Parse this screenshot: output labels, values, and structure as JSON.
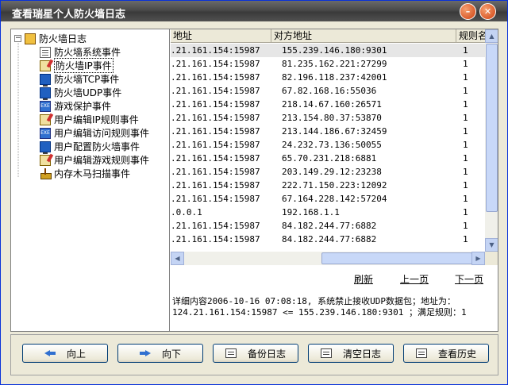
{
  "window": {
    "title": "查看瑞星个人防火墙日志"
  },
  "tree": {
    "root": "防火墙日志",
    "items": [
      "防火墙系统事件",
      "防火墙IP事件",
      "防火墙TCP事件",
      "防火墙UDP事件",
      "游戏保护事件",
      "用户编辑IP规则事件",
      "用户编辑访问规则事件",
      "用户配置防火墙事件",
      "用户编辑游戏规则事件",
      "内存木马扫描事件"
    ],
    "selected_index": 1
  },
  "table": {
    "columns": [
      "地址",
      "对方地址",
      "规则名"
    ],
    "rows": [
      [
        ".21.161.154:15987",
        "155.239.146.180:9301",
        "1"
      ],
      [
        ".21.161.154:15987",
        "81.235.162.221:27299",
        "1"
      ],
      [
        ".21.161.154:15987",
        "82.196.118.237:42001",
        "1"
      ],
      [
        ".21.161.154:15987",
        "67.82.168.16:55036",
        "1"
      ],
      [
        ".21.161.154:15987",
        "218.14.67.160:26571",
        "1"
      ],
      [
        ".21.161.154:15987",
        "213.154.80.37:53870",
        "1"
      ],
      [
        ".21.161.154:15987",
        "213.144.186.67:32459",
        "1"
      ],
      [
        ".21.161.154:15987",
        "24.232.73.136:50055",
        "1"
      ],
      [
        ".21.161.154:15987",
        "65.70.231.218:6881",
        "1"
      ],
      [
        ".21.161.154:15987",
        "203.149.29.12:23238",
        "1"
      ],
      [
        ".21.161.154:15987",
        "222.71.150.223:12092",
        "1"
      ],
      [
        ".21.161.154:15987",
        "67.164.228.142:57204",
        "1"
      ],
      [
        ".0.0.1",
        "192.168.1.1",
        "1"
      ],
      [
        ".21.161.154:15987",
        "84.182.244.77:6882",
        "1"
      ],
      [
        ".21.161.154:15987",
        "84.182.244.77:6882",
        "1"
      ]
    ],
    "selected_row": 0
  },
  "pager": {
    "refresh": "刷新",
    "prev": "上一页",
    "next": "下一页"
  },
  "detail": "详细内容2006-10-16 07:08:18, 系统禁止接收UDP数据包；地址为：\n124.21.161.154:15987 <= 155.239.146.180:9301 ；满足规则：1",
  "buttons": {
    "up": "向上",
    "down": "向下",
    "backup": "备份日志",
    "clear": "清空日志",
    "history": "查看历史"
  }
}
